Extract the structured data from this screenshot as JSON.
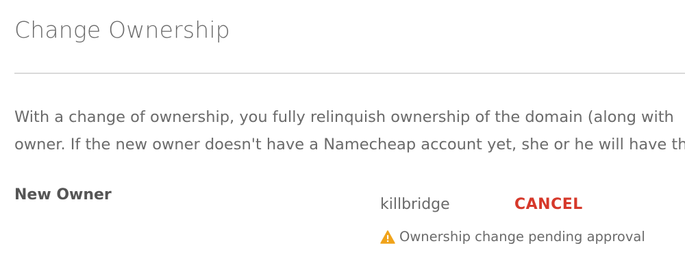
{
  "section": {
    "title": "Change Ownership"
  },
  "description": {
    "line1": "With a change of ownership, you fully relinquish ownership of the domain (along with",
    "line2": "owner. If the new owner doesn't have a Namecheap account yet, she or he will have th"
  },
  "new_owner": {
    "label": "New Owner",
    "username": "killbridge",
    "cancel_label": "CANCEL",
    "status_icon": "warning-icon",
    "status_text": "Ownership change pending approval"
  },
  "colors": {
    "accent": "#d6382a",
    "warning": "#f0a31a",
    "text": "#6a6a6a"
  }
}
